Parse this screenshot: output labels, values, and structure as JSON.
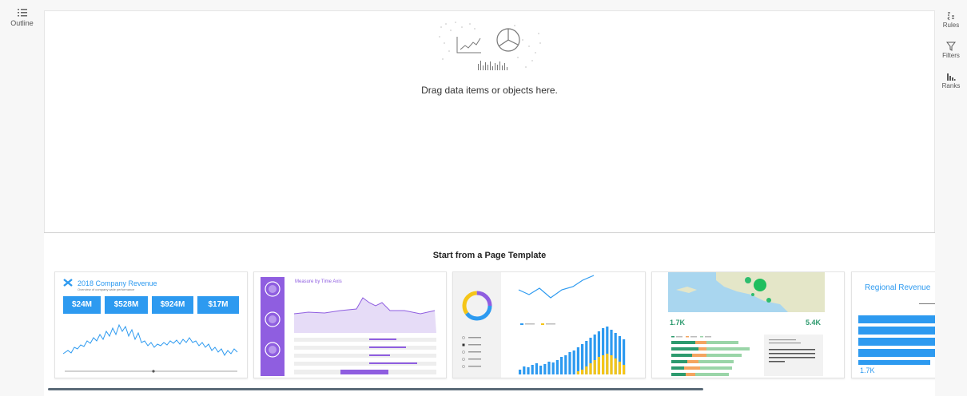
{
  "left_rail": {
    "outline": {
      "label": "Outline",
      "icon": "outline-icon"
    }
  },
  "right_rail": {
    "items": [
      {
        "label": "Rules",
        "icon": "rules-icon"
      },
      {
        "label": "Filters",
        "icon": "filter-icon"
      },
      {
        "label": "Ranks",
        "icon": "ranks-icon"
      }
    ]
  },
  "canvas": {
    "drop_text": "Drag data items or objects here."
  },
  "templates": {
    "title": "Start from a Page Template",
    "cards": [
      {
        "title": "2018 Company Revenue",
        "subtitle": "Overview of company wide performance",
        "kpis": [
          "$24M",
          "$528M",
          "$924M",
          "$17M"
        ]
      },
      {
        "title": "Measure by Time Axis"
      },
      {
        "title": ""
      },
      {
        "values": [
          "1.7K",
          "5.4K"
        ]
      },
      {
        "title": "Regional Revenue",
        "value": "1.7K"
      }
    ]
  },
  "colors": {
    "accent_blue": "#2d9af0",
    "accent_purple": "#8f5ee0",
    "accent_green": "#2d9a6e",
    "accent_yellow": "#f5c518"
  }
}
